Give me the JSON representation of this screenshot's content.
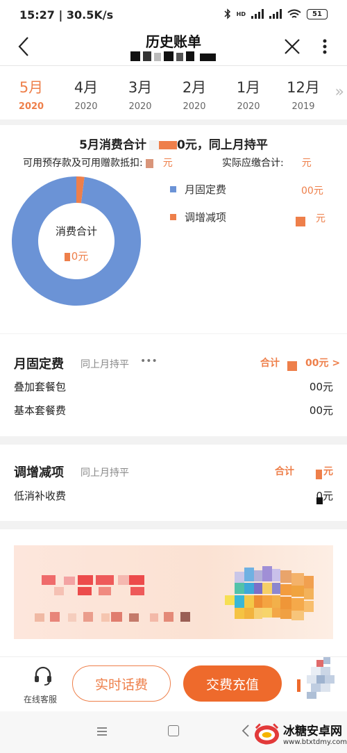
{
  "status_bar": {
    "time_speed": "15:27 | 30.5K/s",
    "network": "HD",
    "battery": "51"
  },
  "header": {
    "title": "历史账单"
  },
  "month_tabs": [
    {
      "month": "5月",
      "year": "2020",
      "active": true
    },
    {
      "month": "4月",
      "year": "2020",
      "active": false
    },
    {
      "month": "3月",
      "year": "2020",
      "active": false
    },
    {
      "month": "2月",
      "year": "2020",
      "active": false
    },
    {
      "month": "1月",
      "year": "2020",
      "active": false
    },
    {
      "month": "12月",
      "year": "2019",
      "active": false
    }
  ],
  "summary": {
    "title_prefix": "5月消费合计",
    "title_suffix": "0元，同上月持平",
    "deduct_label": "可用预存款及可用赠款抵扣:",
    "deduct_value": "元",
    "actual_label": "实际应缴合计:",
    "actual_value": "元"
  },
  "chart_data": {
    "type": "pie",
    "categories": [
      "月固定费",
      "调增减项"
    ],
    "values": [
      98,
      2
    ],
    "center_label": "消费合计",
    "center_value": "0元",
    "colors": [
      "#6b93d6",
      "#ee7f4a"
    ]
  },
  "legend": [
    {
      "label": "月固定费",
      "value": "00元",
      "color": "#6b93d6"
    },
    {
      "label": "调增减项",
      "value": "元",
      "color": "#ee7f4a"
    }
  ],
  "section_fixed": {
    "title": "月固定费",
    "subtitle": "同上月持平",
    "more": "•••",
    "total_label": "合计",
    "total_value": "00元 >",
    "items": [
      {
        "label": "叠加套餐包",
        "value": "00元"
      },
      {
        "label": "基本套餐费",
        "value": "00元"
      }
    ]
  },
  "section_adjust": {
    "title": "调增减项",
    "subtitle": "同上月持平",
    "total_label": "合计",
    "total_value": "元",
    "items": [
      {
        "label": "低消补收费",
        "value": "0元"
      }
    ]
  },
  "actions": {
    "service_label": "在线客服",
    "realtime_fee": "实时话费",
    "recharge": "交费充值"
  },
  "watermark": {
    "name": "冰糖安卓网",
    "url": "www.btxtdmy.com"
  }
}
